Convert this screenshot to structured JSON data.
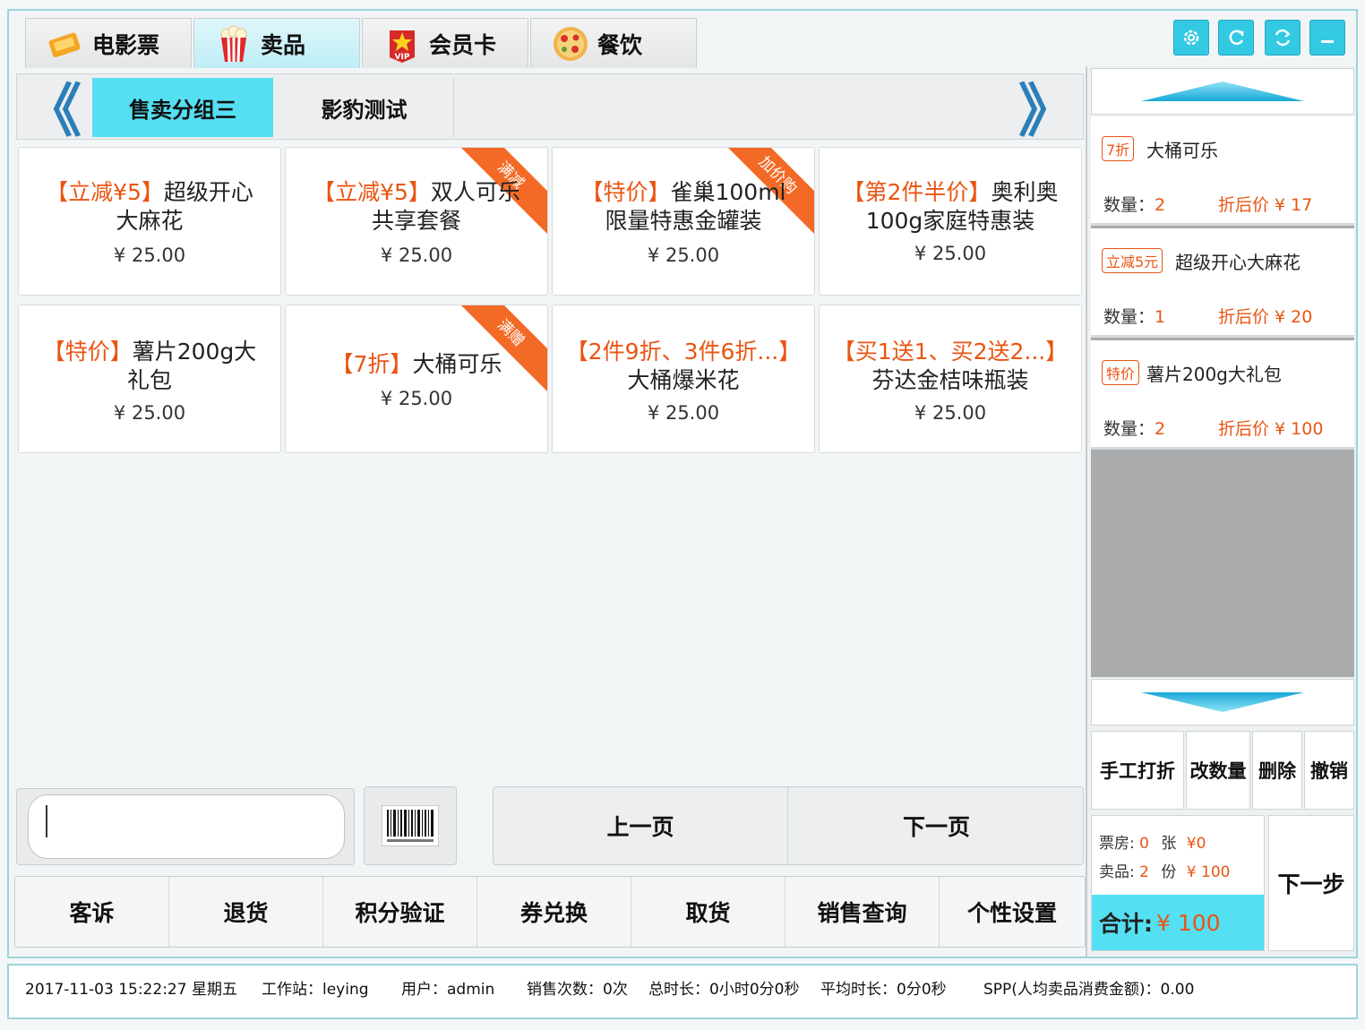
{
  "tabs": [
    {
      "label": "电影票",
      "icon": "ticket-icon"
    },
    {
      "label": "卖品",
      "icon": "popcorn-icon"
    },
    {
      "label": "会员卡",
      "icon": "vip-card-icon"
    },
    {
      "label": "餐饮",
      "icon": "pizza-icon"
    }
  ],
  "toolbar": {
    "icons": [
      "settings-icon",
      "refresh-icon",
      "sync-icon",
      "minimize-icon"
    ]
  },
  "categories": {
    "prev": "《",
    "next": "》",
    "items": [
      "售卖分组三",
      "影豹测试"
    ],
    "active_index": 0
  },
  "products": [
    {
      "promo": "【立减¥5】",
      "name_line1": "超级开心",
      "name_line2": "大麻花",
      "price": "¥ 25.00",
      "ribbon": ""
    },
    {
      "promo": "【立减¥5】",
      "name_line1": "双人可乐",
      "name_line2": "共享套餐",
      "price": "¥ 25.00",
      "ribbon": "满减"
    },
    {
      "promo": "【特价】",
      "name_line1": "雀巢100ml",
      "name_line2": "限量特惠金罐装",
      "price": "¥ 25.00",
      "ribbon": "加价购"
    },
    {
      "promo": "【第2件半价】",
      "name_line1": "奥利奥",
      "name_line2": "100g家庭特惠装",
      "price": "¥ 25.00",
      "ribbon": ""
    },
    {
      "promo": "【特价】",
      "name_line1": "薯片200g大",
      "name_line2": "礼包",
      "price": "¥ 25.00",
      "ribbon": ""
    },
    {
      "promo": "【7折】",
      "name_line1": "大桶可乐",
      "name_line2": "",
      "price": "¥ 25.00",
      "ribbon": "满赠"
    },
    {
      "promo": "【2件9折、3件6折...】",
      "name_line1": "",
      "name_line2": "大桶爆米花",
      "price": "¥ 25.00",
      "ribbon": ""
    },
    {
      "promo": "【买1送1、买2送2...】",
      "name_line1": "",
      "name_line2": "芬达金桔味瓶装",
      "price": "¥ 25.00",
      "ribbon": ""
    }
  ],
  "input": {
    "value": ""
  },
  "pager": {
    "prev": "上一页",
    "next": "下一页"
  },
  "functions": [
    "客诉",
    "退货",
    "积分验证",
    "券兑换",
    "取货",
    "销售查询",
    "个性设置"
  ],
  "order": {
    "items": [
      {
        "tag": "7折",
        "name": "大桶可乐",
        "qty_label": "数量：",
        "qty": "2",
        "disc": "折后价 ¥ 17"
      },
      {
        "tag": "立减5元",
        "name": "超级开心大麻花",
        "qty_label": "数量：",
        "qty": "1",
        "disc": "折后价 ¥ 20"
      },
      {
        "tag": "特价",
        "name": "薯片200g大礼包",
        "qty_label": "数量：",
        "qty": "2",
        "disc": "折后价 ¥ 100"
      }
    ],
    "actions": [
      "手工打折",
      "改数量",
      "删除",
      "撤销"
    ],
    "summary": {
      "ticket_label": "票房:",
      "ticket_count": "0",
      "ticket_unit": "张",
      "ticket_amount": "¥0",
      "snack_label": "卖品:",
      "snack_count": "2",
      "snack_unit": "份",
      "snack_amount": "¥ 100",
      "total_label": "合计:",
      "total_value": "¥ 100"
    },
    "next_step": "下一步"
  },
  "status": {
    "datetime": "2017-11-03 15:22:27 星期五",
    "workstation": "工作站：leying",
    "user": "用户：admin",
    "sales_count": "销售次数：0次",
    "total_duration": "总时长：0小时0分0秒",
    "avg_duration": "平均时长：0分0秒",
    "spp": "SPP(人均卖品消费金额)：0.00"
  },
  "colors": {
    "accent": "#55dff2",
    "promo": "#e95513",
    "ribbon": "#f26a25",
    "border": "#9cd4dc"
  }
}
